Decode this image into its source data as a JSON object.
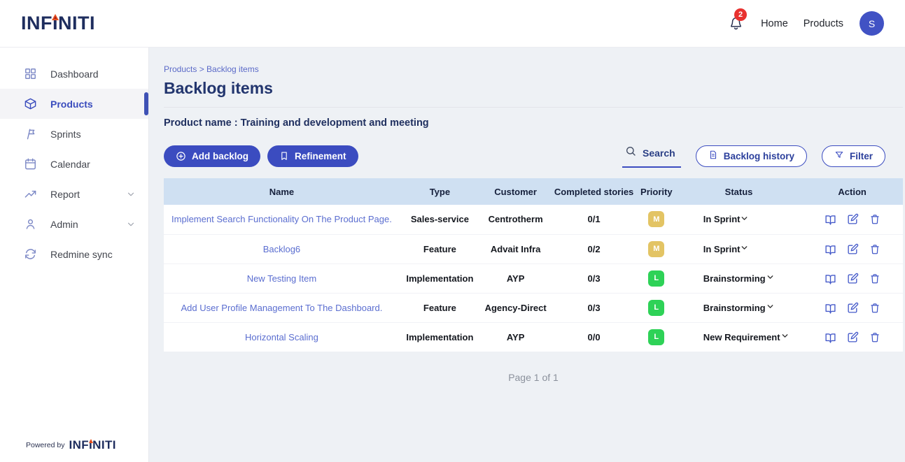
{
  "brand": {
    "logo_part1": "INF",
    "logo_part2": "I",
    "logo_part3": "NITI",
    "powered_by": "Powered by"
  },
  "header": {
    "notification_count": "2",
    "nav": [
      {
        "label": "Home"
      },
      {
        "label": "Products"
      }
    ],
    "avatar_initial": "S"
  },
  "sidebar": {
    "items": [
      {
        "label": "Dashboard",
        "icon": "grid-icon"
      },
      {
        "label": "Products",
        "icon": "cube-icon",
        "active": true
      },
      {
        "label": "Sprints",
        "icon": "sprint-flag-icon"
      },
      {
        "label": "Calendar",
        "icon": "calendar-icon"
      },
      {
        "label": "Report",
        "icon": "trending-up-icon",
        "expandable": true
      },
      {
        "label": "Admin",
        "icon": "person-icon",
        "expandable": true
      },
      {
        "label": "Redmine sync",
        "icon": "sync-icon"
      }
    ]
  },
  "main": {
    "breadcrumb": "Products > Backlog items",
    "page_title": "Backlog items",
    "product_label": "Product name : Training and development and meeting",
    "actions": {
      "add_backlog": "Add backlog",
      "refinement": "Refinement",
      "search": "Search",
      "backlog_history": "Backlog history",
      "filter": "Filter"
    },
    "table": {
      "columns": [
        "Name",
        "Type",
        "Customer",
        "Completed stories",
        "Priority",
        "Status",
        "Action"
      ],
      "rows": [
        {
          "name": "Implement Search Functionality On The Product Page.",
          "type": "Sales-service",
          "customer": "Centrotherm",
          "completed": "0/1",
          "priority": "M",
          "priority_color": "#e3c464",
          "status": "In Sprint"
        },
        {
          "name": "Backlog6",
          "type": "Feature",
          "customer": "Advait Infra",
          "completed": "0/2",
          "priority": "M",
          "priority_color": "#e3c464",
          "status": "In Sprint"
        },
        {
          "name": "New Testing Item",
          "type": "Implementation",
          "customer": "AYP",
          "completed": "0/3",
          "priority": "L",
          "priority_color": "#2ed257",
          "status": "Brainstorming"
        },
        {
          "name": "Add User Profile Management To The Dashboard.",
          "type": "Feature",
          "customer": "Agency-Direct",
          "completed": "0/3",
          "priority": "L",
          "priority_color": "#2ed257",
          "status": "Brainstorming"
        },
        {
          "name": "Horizontal Scaling",
          "type": "Implementation",
          "customer": "AYP",
          "completed": "0/0",
          "priority": "L",
          "priority_color": "#2ed257",
          "status": "New Requirement"
        }
      ]
    },
    "pagination": "Page 1 of 1"
  },
  "colors": {
    "accent": "#3b4cc0",
    "link": "#5b6ed0",
    "table_header_bg": "#cfe0f2",
    "priority_medium": "#e3c464",
    "priority_low": "#2ed257",
    "notification_badge": "#e8312f",
    "avatar_bg": "#4152c4",
    "logo_navy": "#1e2d5e",
    "logo_flame": "#e8501e"
  }
}
